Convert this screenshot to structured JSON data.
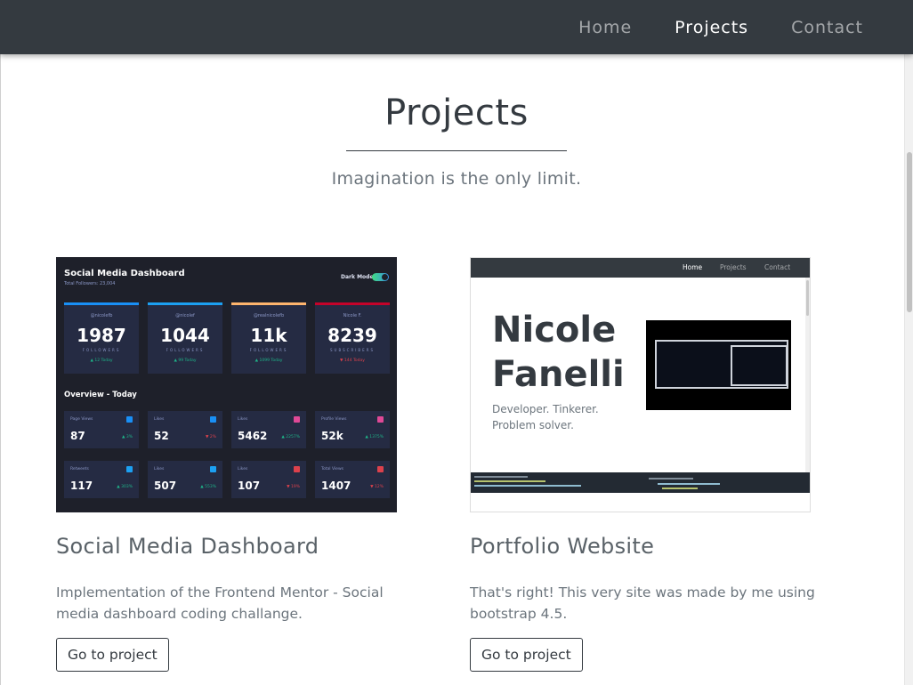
{
  "nav": {
    "links": [
      {
        "label": "Home",
        "active": false
      },
      {
        "label": "Projects",
        "active": true
      },
      {
        "label": "Contact",
        "active": false
      }
    ]
  },
  "header": {
    "title": "Projects",
    "subtitle": "Imagination is the only limit."
  },
  "projects": [
    {
      "title": "Social Media Dashboard",
      "description": "Implementation of the Frontend Mentor - Social media dashboard coding challange.",
      "button_label": "Go to project",
      "thumbnail": {
        "title": "Social Media Dashboard",
        "subtitle": "Total Followers: 23,004",
        "mode_label": "Dark Mode",
        "stats": [
          {
            "handle": "@nicolefb",
            "value": "1987",
            "unit": "FOLLOWERS",
            "today": "▲ 12 Today",
            "color": "#198ff5",
            "down": false
          },
          {
            "handle": "@nicolef",
            "value": "1044",
            "unit": "FOLLOWERS",
            "today": "▲ 99 Today",
            "color": "#1ca0f2",
            "down": false
          },
          {
            "handle": "@realnicolefb",
            "value": "11k",
            "unit": "FOLLOWERS",
            "today": "▲ 1099 Today",
            "color": "#fdb46d",
            "down": false
          },
          {
            "handle": "Nicole F.",
            "value": "8239",
            "unit": "SUBSCRIBERS",
            "today": "▼ 144 Today",
            "color": "#c4032a",
            "down": true
          }
        ],
        "overview_title": "Overview - Today",
        "overview": [
          {
            "label": "Page Views",
            "value": "87",
            "pct": "▲ 3%",
            "icon_color": "#198ff5",
            "down": false
          },
          {
            "label": "Likes",
            "value": "52",
            "pct": "▼ 2%",
            "icon_color": "#198ff5",
            "down": true
          },
          {
            "label": "Likes",
            "value": "5462",
            "pct": "▲ 2257%",
            "icon_color": "#df4996",
            "down": false
          },
          {
            "label": "Profile Views",
            "value": "52k",
            "pct": "▲ 1375%",
            "icon_color": "#df4996",
            "down": false
          },
          {
            "label": "Retweets",
            "value": "117",
            "pct": "▲ 303%",
            "icon_color": "#1ca0f2",
            "down": false
          },
          {
            "label": "Likes",
            "value": "507",
            "pct": "▲ 553%",
            "icon_color": "#1ca0f2",
            "down": false
          },
          {
            "label": "Likes",
            "value": "107",
            "pct": "▼ 19%",
            "icon_color": "#dc414c",
            "down": true
          },
          {
            "label": "Total Views",
            "value": "1407",
            "pct": "▼ 12%",
            "icon_color": "#dc414c",
            "down": true
          }
        ]
      }
    },
    {
      "title": "Portfolio Website",
      "description": "That's right! This very site was made by me using bootstrap 4.5.",
      "button_label": "Go to project",
      "thumbnail": {
        "nav": [
          "Home",
          "Projects",
          "Contact"
        ],
        "name_line1": "Nicole",
        "name_line2": "Fanelli",
        "tagline_line1": "Developer. Tinkerer.",
        "tagline_line2": "Problem solver."
      }
    }
  ],
  "colors": {
    "navbar": "#343a40",
    "text": "#343a40",
    "muted": "#6c757d"
  }
}
